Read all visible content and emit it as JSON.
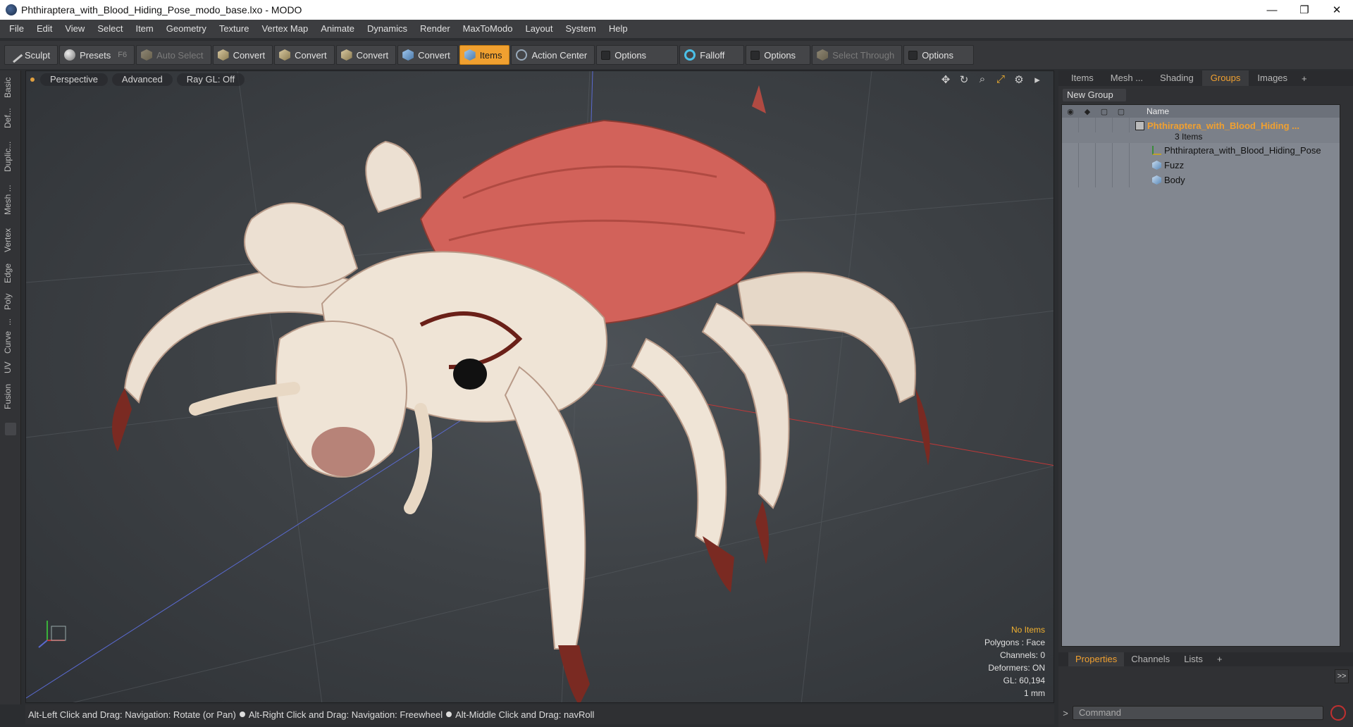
{
  "window": {
    "title": "Phthiraptera_with_Blood_Hiding_Pose_modo_base.lxo - MODO",
    "minimize": "—",
    "restore": "❐",
    "close": "✕"
  },
  "menu": [
    "File",
    "Edit",
    "View",
    "Select",
    "Item",
    "Geometry",
    "Texture",
    "Vertex Map",
    "Animate",
    "Dynamics",
    "Render",
    "MaxToModo",
    "Layout",
    "System",
    "Help"
  ],
  "toolbar": {
    "sculpt": "Sculpt",
    "presets": "Presets",
    "presets_key": "F6",
    "auto_select": "Auto Select",
    "convert1": "Convert",
    "convert2": "Convert",
    "convert3": "Convert",
    "convert4": "Convert",
    "items": "Items",
    "action_center": "Action Center",
    "options1": "Options",
    "falloff": "Falloff",
    "options2": "Options",
    "select_through": "Select Through",
    "options3": "Options"
  },
  "left_tabs": [
    "Basic",
    "Def...",
    "Duplic...",
    "Mesh ...",
    "Vertex",
    "Edge",
    "Poly",
    "...",
    "Curve",
    "UV",
    "Fusion"
  ],
  "viewport": {
    "perspective": "Perspective",
    "advanced": "Advanced",
    "raygl": "Ray GL: Off",
    "icons": {
      "move": "✥",
      "rotate": "↻",
      "zoom": "⌕",
      "maximize": "⤢",
      "settings": "⚙",
      "more": "▸"
    },
    "stats": {
      "no_items": "No Items",
      "polygons": "Polygons : Face",
      "channels": "Channels: 0",
      "deformers": "Deformers: ON",
      "gl": "GL: 60,194",
      "unit": "1 mm"
    }
  },
  "status": {
    "hint1": "Alt-Left Click and Drag: Navigation: Rotate (or Pan)",
    "hint2": "Alt-Right Click and Drag: Navigation: Freewheel",
    "hint3": "Alt-Middle Click and Drag: navRoll"
  },
  "right_panel": {
    "tabs": [
      "Items",
      "Mesh ...",
      "Shading",
      "Groups",
      "Images"
    ],
    "active_tab": "Groups",
    "new_group": "New Group",
    "tree_header_name": "Name",
    "group_name": "Phthiraptera_with_Blood_Hiding ...",
    "group_count": "3 Items",
    "children": [
      "Phthiraptera_with_Blood_Hiding_Pose",
      "Fuzz",
      "Body"
    ],
    "lower_tabs": [
      "Properties",
      "Channels",
      "Lists"
    ],
    "arrow": ">>",
    "command_placeholder": "Command"
  },
  "colors": {
    "accent": "#f0a030",
    "viewport_bg": "#3e4246"
  }
}
